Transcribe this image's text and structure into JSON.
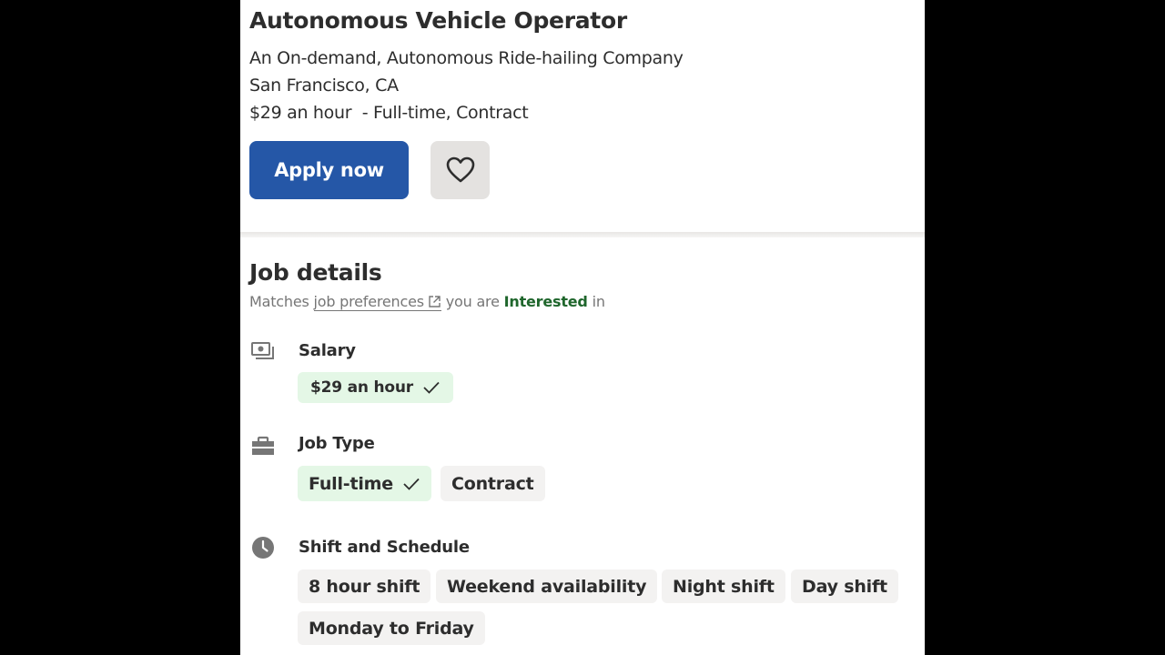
{
  "job": {
    "title": "Autonomous Vehicle Operator",
    "company": "An On-demand, Autonomous Ride-hailing Company",
    "location": "San Francisco, CA",
    "pay_and_type": "$29 an hour  - Full-time, Contract",
    "apply_label": "Apply now"
  },
  "details": {
    "title": "Job details",
    "prefs_prefix": "Matches",
    "prefs_link": "job preferences",
    "prefs_middle": "you are",
    "prefs_status": "Interested",
    "prefs_suffix": "in",
    "salary": {
      "label": "Salary",
      "tags": [
        "$29 an hour"
      ]
    },
    "job_type": {
      "label": "Job Type",
      "tags": [
        "Full-time",
        "Contract"
      ]
    },
    "schedule": {
      "label": "Shift and Schedule",
      "tags": [
        "8 hour shift",
        "Weekend availability",
        "Night shift",
        "Day shift",
        "Monday to Friday"
      ]
    }
  },
  "colors": {
    "brand_blue": "#2557a7",
    "match_green": "#1f662c",
    "match_bg": "#e4f7e6",
    "tag_bg": "#f3f2f1"
  },
  "icons": {
    "save": "heart-icon",
    "external_link": "external-link-icon",
    "salary": "money-icon",
    "job_type": "briefcase-icon",
    "schedule": "clock-icon",
    "match": "checkmark-icon"
  }
}
